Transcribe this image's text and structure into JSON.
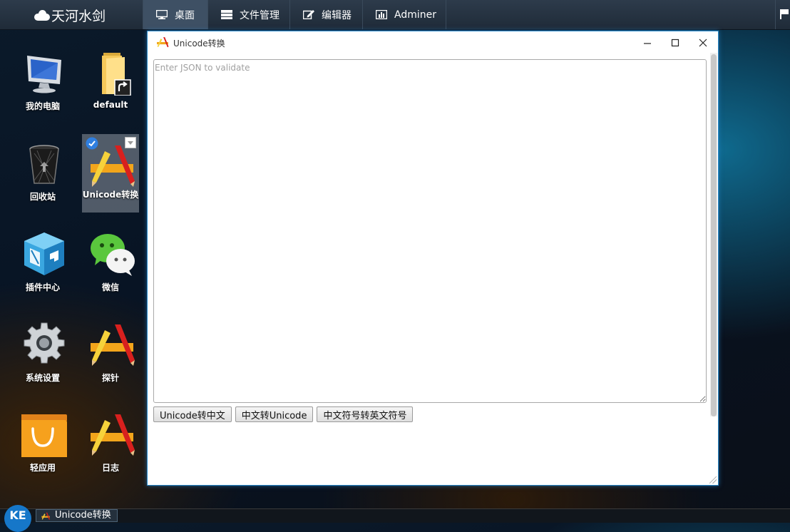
{
  "topbar": {
    "logo_text": "天河水剑",
    "tabs": [
      {
        "label": "桌面",
        "icon": "monitor-icon",
        "active": true
      },
      {
        "label": "文件管理",
        "icon": "folder-drive-icon",
        "active": false
      },
      {
        "label": "编辑器",
        "icon": "edit-icon",
        "active": false
      },
      {
        "label": "Adminer",
        "icon": "chart-icon",
        "active": false
      }
    ],
    "right_icon": "flag-icon"
  },
  "desktop": {
    "icons": [
      {
        "label": "我的电脑",
        "icon": "computer-icon"
      },
      {
        "label": "default",
        "icon": "folder-shortcut-icon"
      },
      {
        "label": "回收站",
        "icon": "recycle-bin-icon"
      },
      {
        "label": "Unicode转换",
        "icon": "app-pencil-ruler-icon",
        "selected": true
      },
      {
        "label": "插件中心",
        "icon": "plugin-box-icon"
      },
      {
        "label": "微信",
        "icon": "wechat-icon"
      },
      {
        "label": "系统设置",
        "icon": "gear-icon"
      },
      {
        "label": "探针",
        "icon": "app-pencil-ruler-icon"
      },
      {
        "label": "轻应用",
        "icon": "shopping-bag-icon"
      },
      {
        "label": "日志",
        "icon": "app-pencil-ruler-icon"
      }
    ]
  },
  "window": {
    "title": "Unicode转换",
    "textarea_placeholder": "Enter JSON to validate",
    "textarea_value": "",
    "buttons": [
      {
        "label": "Unicode转中文"
      },
      {
        "label": "中文转Unicode"
      },
      {
        "label": "中文符号转英文符号"
      }
    ],
    "accent": "#2a88c8"
  },
  "taskbar": {
    "start_label": "KE",
    "task_label": "Unicode转换"
  }
}
